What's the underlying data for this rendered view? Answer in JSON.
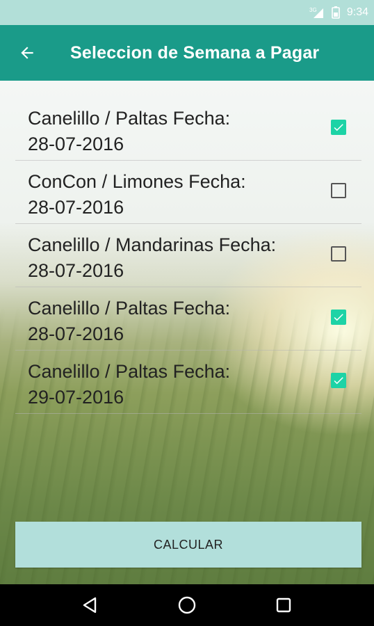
{
  "status_bar": {
    "network": "3G",
    "time": "9:34"
  },
  "app_bar": {
    "title": "Seleccion de Semana a Pagar",
    "back_icon": "arrow-left-icon"
  },
  "items": [
    {
      "label": "Canelillo / Paltas Fecha:\n28-07-2016",
      "checked": true
    },
    {
      "label": "ConCon / Limones Fecha:\n28-07-2016",
      "checked": false
    },
    {
      "label": "Canelillo / Mandarinas Fecha:\n28-07-2016",
      "checked": false
    },
    {
      "label": "Canelillo / Paltas Fecha:\n28-07-2016",
      "checked": true
    },
    {
      "label": "Canelillo / Paltas Fecha:\n29-07-2016",
      "checked": true
    }
  ],
  "calcular_button": {
    "label": "CALCULAR"
  },
  "colors": {
    "accent": "#1a9b89",
    "checkbox": "#1dd3a6",
    "button": "#b2dfdb"
  },
  "nav": {
    "back": "nav-back-icon",
    "home": "nav-home-icon",
    "recents": "nav-recents-icon"
  }
}
